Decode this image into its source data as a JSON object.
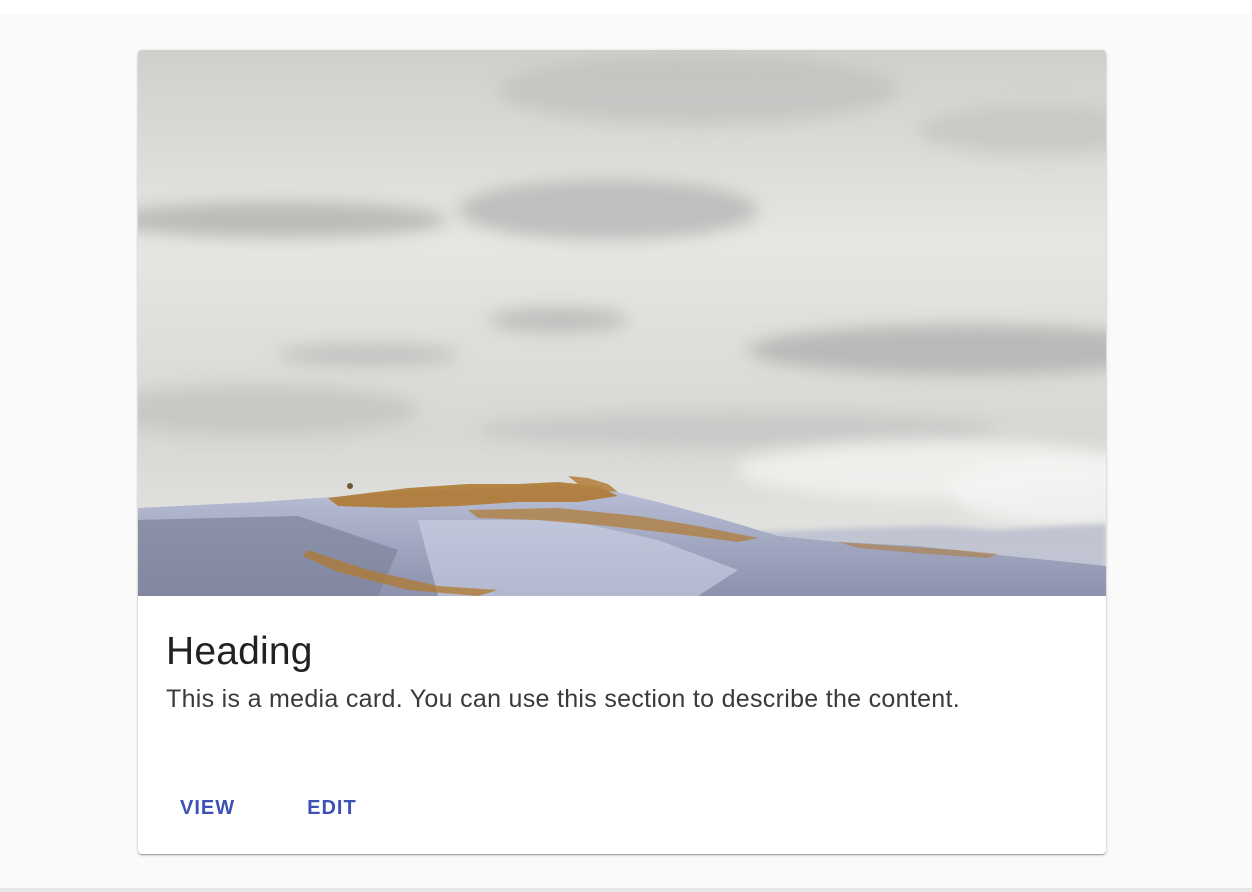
{
  "card": {
    "heading": "Heading",
    "description": "This is a media card. You can use this section to describe the content.",
    "actions": {
      "view_label": "VIEW",
      "edit_label": "EDIT"
    },
    "media_icon": "landscape-photo",
    "accent_color": "#3f51b5"
  }
}
